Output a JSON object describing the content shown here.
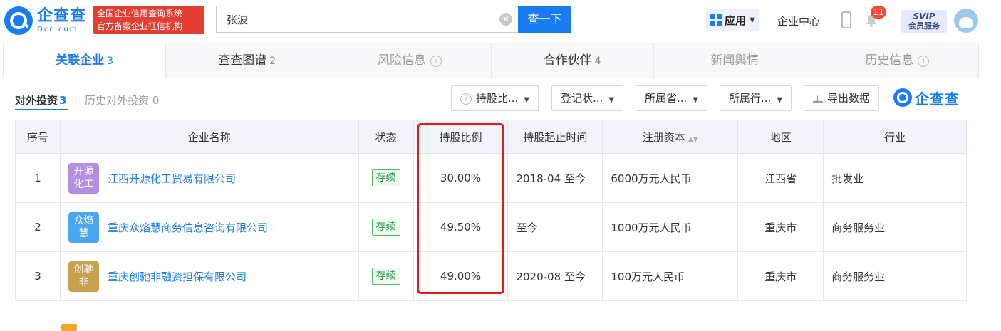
{
  "header": {
    "logo_cn": "企查查",
    "logo_en": "Qcc.com",
    "slogan_line1": "全国企业信用查询系统",
    "slogan_line2": "官方备案企业征信机构",
    "search_value": "张波",
    "search_button": "查一下",
    "apps_label": "应用",
    "center_link": "企业中心",
    "notification_count": "11",
    "vip_line1": "SVIP",
    "vip_line2": "会员服务",
    "brand_color": "#1a7cf2"
  },
  "tabs": [
    {
      "label": "关联企业",
      "count": "3"
    },
    {
      "label": "查查图谱",
      "count": "2"
    },
    {
      "label": "风险信息",
      "count": ""
    },
    {
      "label": "合作伙伴",
      "count": "4"
    },
    {
      "label": "新闻舆情",
      "count": ""
    },
    {
      "label": "历史信息",
      "count": ""
    }
  ],
  "toolbar": {
    "subtab_active": "对外投资",
    "subtab_active_count": "3",
    "subtab_inactive": "历史对外投资 0",
    "filter_share": "持股比...",
    "filter_status": "登记状...",
    "filter_province": "所属省...",
    "filter_industry": "所属行...",
    "export_label": "导出数据",
    "brand_label": "企查查"
  },
  "table": {
    "headers": [
      "序号",
      "企业名称",
      "状态",
      "持股比例",
      "持股起止时间",
      "注册资本",
      "地区",
      "行业"
    ],
    "rows": [
      {
        "index": "1",
        "logo": "开源\n化工",
        "logo_color": "#b48ee0",
        "name": "江西开源化工贸易有限公司",
        "status": "存续",
        "share": "30.00%",
        "period": "2018-04 至今",
        "capital": "6000万元人民币",
        "region": "江西省",
        "industry": "批发业"
      },
      {
        "index": "2",
        "logo": "众焰\n慧",
        "logo_color": "#4aa6ee",
        "name": "重庆众焰慧商务信息咨询有限公司",
        "status": "存续",
        "share": "49.50%",
        "period": "至今",
        "capital": "1000万元人民币",
        "region": "重庆市",
        "industry": "商务服务业"
      },
      {
        "index": "3",
        "logo": "创驰\n非",
        "logo_color": "#c9a04e",
        "name": "重庆创驰非融资担保有限公司",
        "status": "存续",
        "share": "49.00%",
        "period": "2020-08 至今",
        "capital": "100万元人民币",
        "region": "重庆市",
        "industry": "商务服务业"
      }
    ]
  }
}
